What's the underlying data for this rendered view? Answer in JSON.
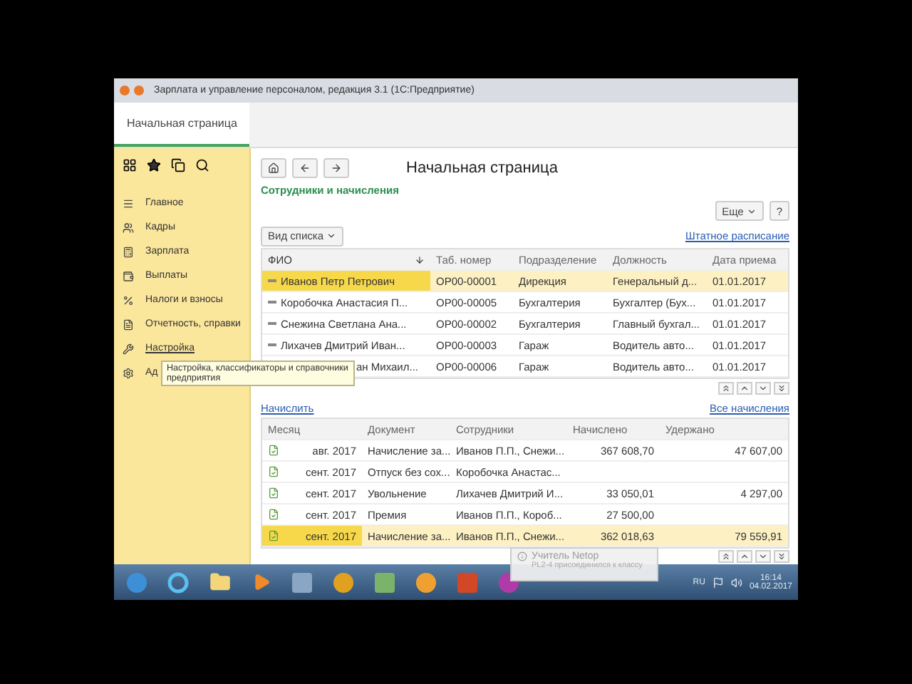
{
  "window": {
    "title": "Зарплата и управление персоналом, редакция 3.1 (1С:Предприятие)"
  },
  "tabs": [
    {
      "label": "Начальная страница",
      "selected": true
    }
  ],
  "sidebar": {
    "items": [
      {
        "label": "Главное",
        "hovered": false
      },
      {
        "label": "Кадры",
        "hovered": false
      },
      {
        "label": "Зарплата",
        "hovered": false
      },
      {
        "label": "Выплаты",
        "hovered": false
      },
      {
        "label": "Налоги и взносы",
        "hovered": false
      },
      {
        "label": "Отчетность, справки",
        "hovered": false
      },
      {
        "label": "Настройка",
        "hovered": true
      },
      {
        "label": "Ад",
        "hovered": false
      }
    ]
  },
  "tooltip": {
    "text": "Настройка, классификаторы и справочники предприятия"
  },
  "page": {
    "title": "Начальная страница",
    "group_title": "Сотрудники и начисления",
    "more_button": "Еще",
    "help_button": "?",
    "view_button": "Вид списка",
    "staff_link": "Штатное расписание"
  },
  "employees": {
    "columns": [
      {
        "label": "ФИО",
        "sorted": true
      },
      {
        "label": "Таб. номер",
        "sorted": false
      },
      {
        "label": "Подразделение",
        "sorted": false
      },
      {
        "label": "Должность",
        "sorted": false
      },
      {
        "label": "Дата приема",
        "sorted": false
      }
    ],
    "rows": [
      {
        "cells": [
          "Иванов Петр Петрович",
          "OP00-00001",
          "Дирекция",
          "Генеральный д...",
          "01.01.2017"
        ],
        "selected": true
      },
      {
        "cells": [
          "Коробочка Анастасия П...",
          "OP00-00005",
          "Бухгалтерия",
          "Бухгалтер (Бух...",
          "01.01.2017"
        ],
        "selected": false
      },
      {
        "cells": [
          "Снежина Светлана Ана...",
          "OP00-00002",
          "Бухгалтерия",
          "Главный бухгал...",
          "01.01.2017"
        ],
        "selected": false
      },
      {
        "cells": [
          "Лихачев Дмитрий Иван...",
          "OP00-00003",
          "Гараж",
          "Водитель авто...",
          "01.01.2017"
        ],
        "selected": false
      },
      {
        "cells": [
          "ан Михаил...",
          "OP00-00006",
          "Гараж",
          "Водитель авто...",
          "01.01.2017"
        ],
        "selected": false
      }
    ]
  },
  "accruals": {
    "action_link": "Начислить",
    "all_link": "Все начисления",
    "columns": [
      {
        "label": "Месяц",
        "kind": "text"
      },
      {
        "label": "Документ",
        "kind": "text"
      },
      {
        "label": "Сотрудники",
        "kind": "text"
      },
      {
        "label": "Начислено",
        "kind": "number"
      },
      {
        "label": "Удержано",
        "kind": "number"
      }
    ],
    "rows": [
      {
        "cells": [
          "авг. 2017",
          "Начисление за...",
          "Иванов П.П., Снежи...",
          "367 608,70",
          "47 607,00"
        ],
        "selected": false
      },
      {
        "cells": [
          "сент. 2017",
          "Отпуск без сох...",
          "Коробочка Анастас...",
          "",
          ""
        ],
        "selected": false
      },
      {
        "cells": [
          "сент. 2017",
          "Увольнение",
          "Лихачев Дмитрий И...",
          "33 050,01",
          "4 297,00"
        ],
        "selected": false
      },
      {
        "cells": [
          "сент. 2017",
          "Премия",
          "Иванов П.П., Короб...",
          "27 500,00",
          ""
        ],
        "selected": false
      },
      {
        "cells": [
          "сент. 2017",
          "Начисление за...",
          "Иванов П.П., Снежи...",
          "362 018,63",
          "79 559,91"
        ],
        "selected": true
      }
    ]
  },
  "notification": {
    "title": "Учитель Netop",
    "text": "PL2-4 присоединился к классу"
  },
  "taskbar": {
    "language": "RU",
    "time": "16:14",
    "date": "04.02.2017"
  }
}
